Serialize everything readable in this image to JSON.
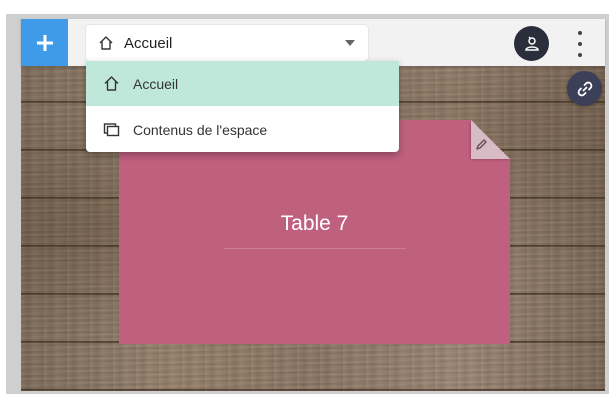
{
  "toolbar": {
    "add_label": "+",
    "space_select": {
      "selected_label": "Accueil",
      "selected_icon": "home-icon"
    },
    "user_icon": "user-badge-icon",
    "more_icon": "more-vert-icon",
    "link_icon": "link-icon"
  },
  "dropdown": {
    "items": [
      {
        "label": "Accueil",
        "icon": "home-icon",
        "active": true
      },
      {
        "label": "Contenus de l'espace",
        "icon": "content-stack-icon",
        "active": false
      }
    ]
  },
  "card": {
    "title": "Table 7",
    "color": "#c0607f",
    "edit_icon": "pencil-icon"
  },
  "colors": {
    "accent_blue": "#3f9be8",
    "active_item": "#bfe8da",
    "dark_button": "#2a2e3a"
  }
}
